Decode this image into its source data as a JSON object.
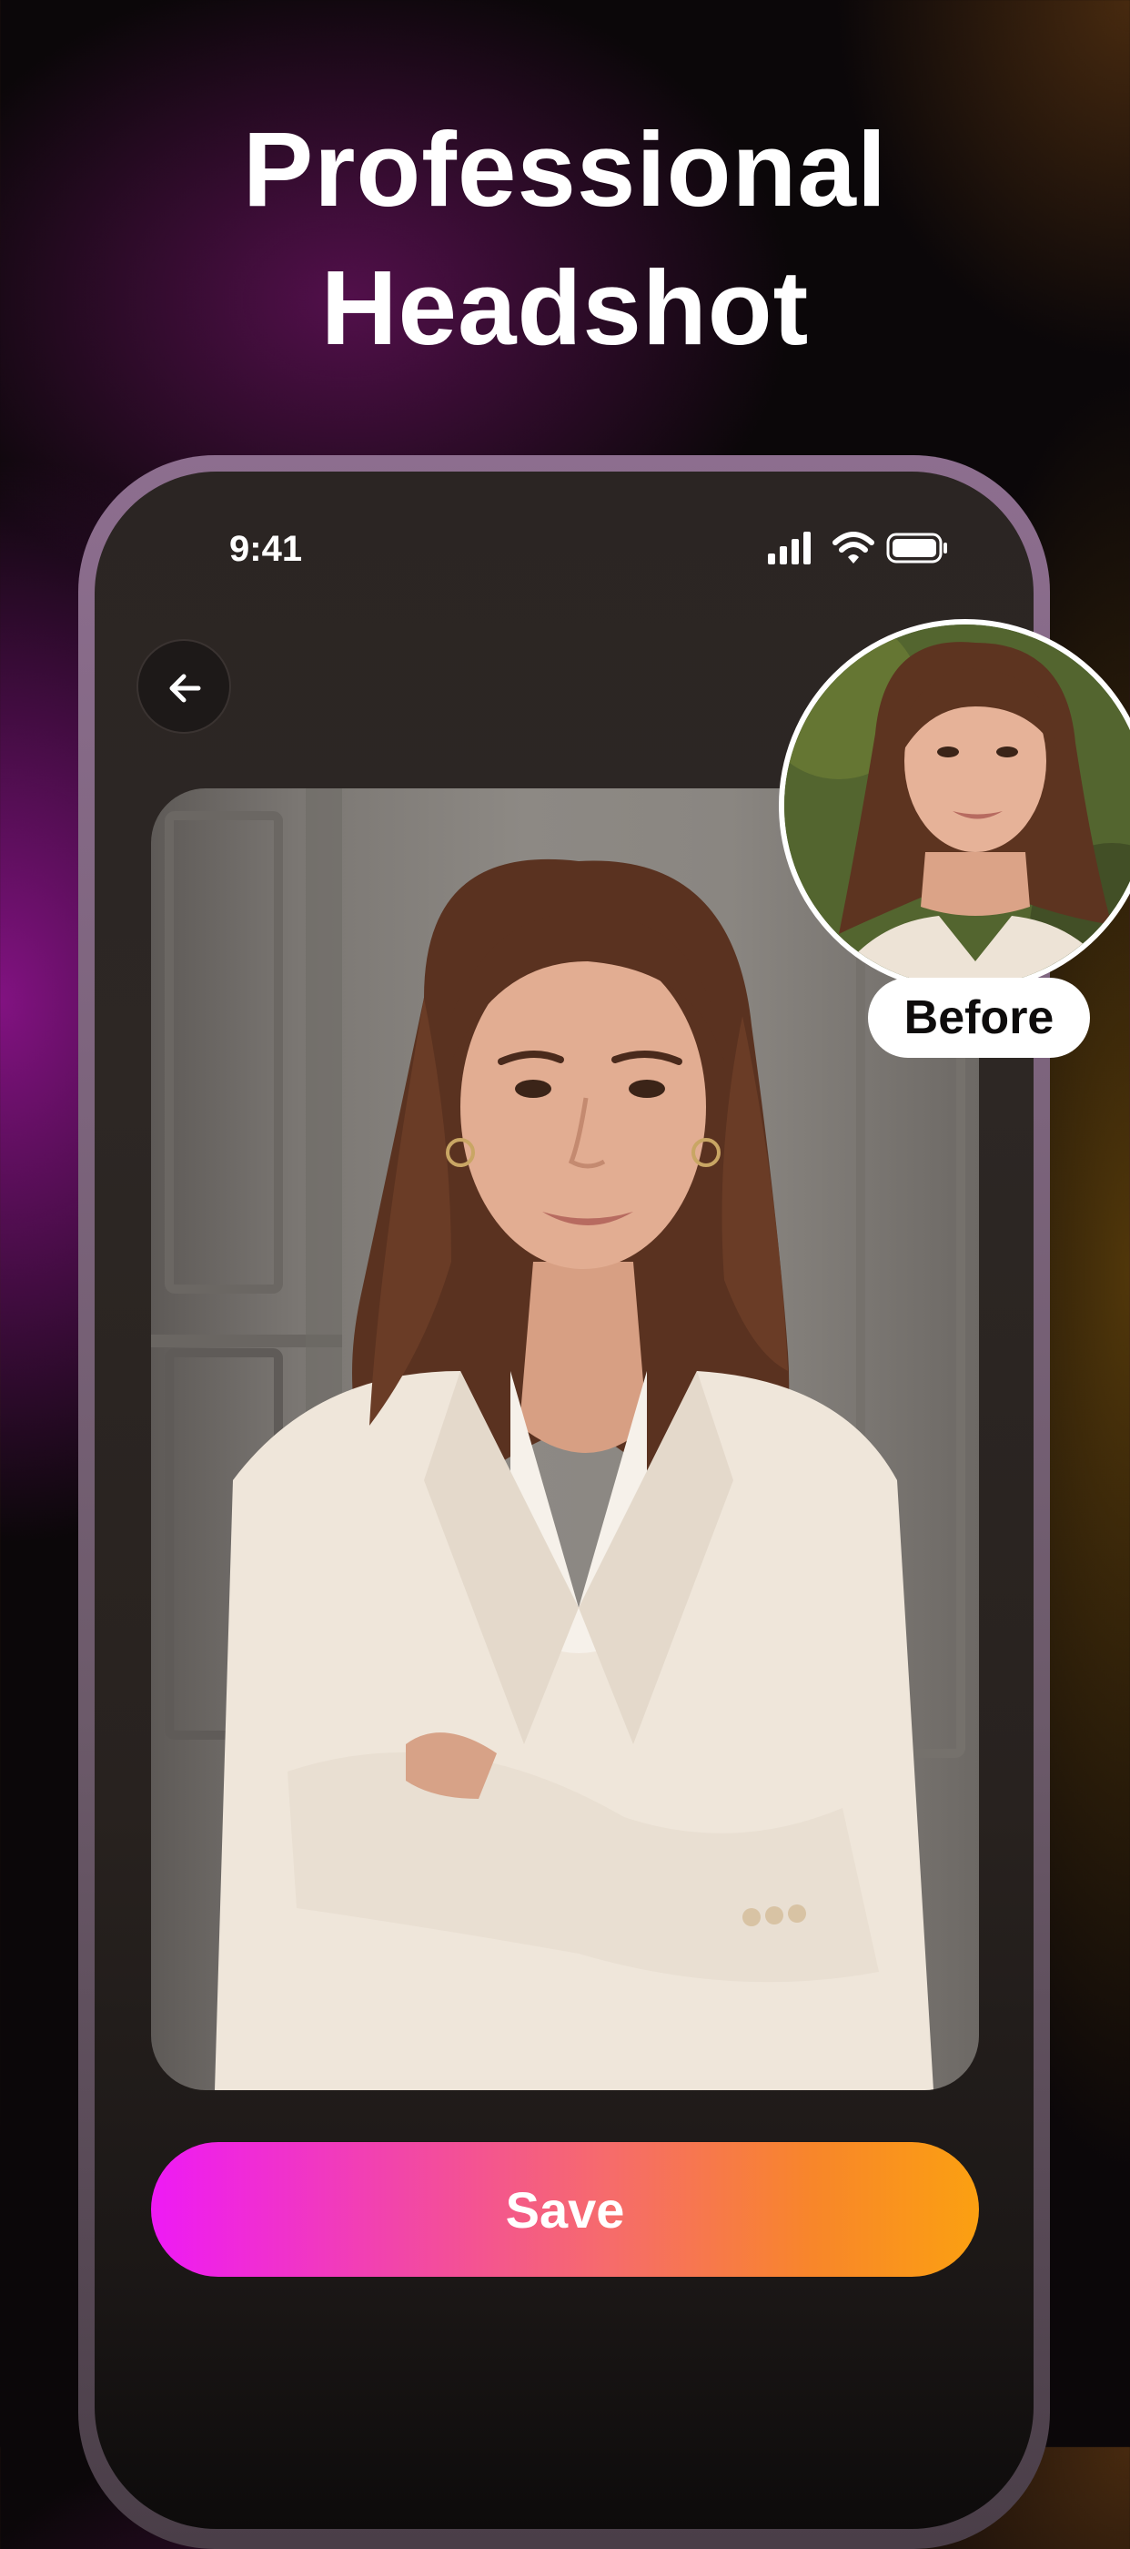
{
  "headline": {
    "line1": "Professional",
    "line2": "Headshot"
  },
  "status_bar": {
    "time": "9:41",
    "icons": [
      "cellular-signal-icon",
      "wifi-icon",
      "battery-icon"
    ]
  },
  "nav": {
    "back_icon": "arrow-left-icon"
  },
  "result_photo": {
    "description_icon": "portrait-photo"
  },
  "before_badge": {
    "label": "Before"
  },
  "actions": {
    "save_label": "Save"
  },
  "colors": {
    "gradient_start": "#ee1af5",
    "gradient_end": "#fba011",
    "background": "#0b0709",
    "phone_frame": "#8d6e8f"
  }
}
